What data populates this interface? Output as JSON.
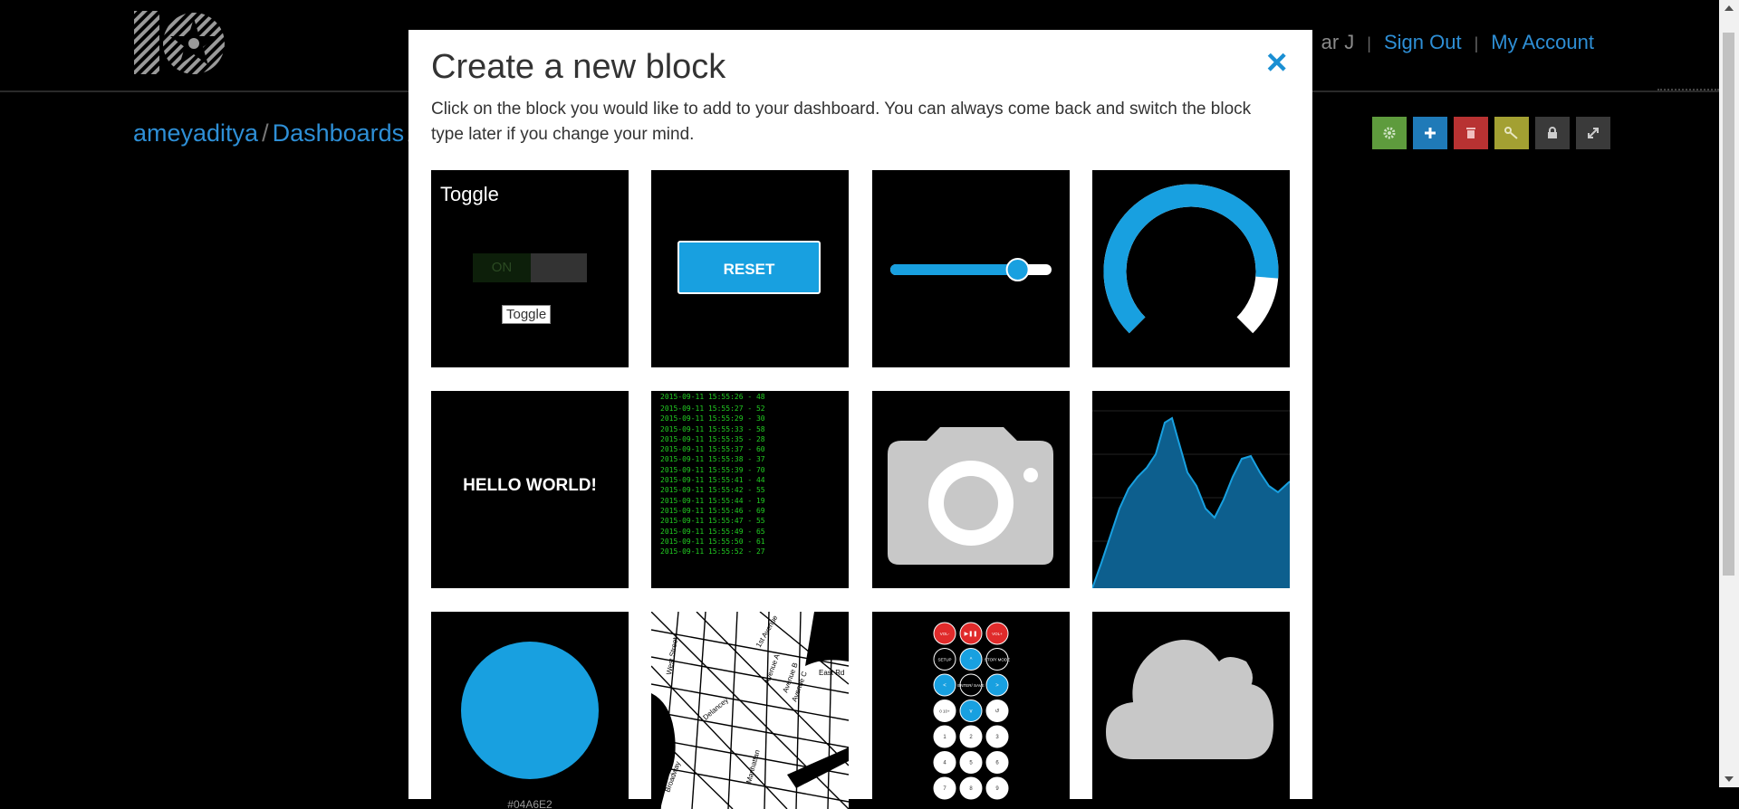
{
  "header": {
    "user_partial": "ar J",
    "sign_out": "Sign Out",
    "my_account": "My Account",
    "separator": "|"
  },
  "breadcrumb": {
    "user": "ameyaditya",
    "dashboards": "Dashboards",
    "separator": "/"
  },
  "toolbar": {
    "buttons": [
      {
        "name": "settings",
        "color": "#5e9b3d",
        "icon": "gear"
      },
      {
        "name": "add-block",
        "color": "#1f7ab8",
        "icon": "plus"
      },
      {
        "name": "delete",
        "color": "#b83232",
        "icon": "trash"
      },
      {
        "name": "key",
        "color": "#a3a032",
        "icon": "key"
      },
      {
        "name": "lock",
        "color": "#3a3a3a",
        "icon": "lock"
      },
      {
        "name": "fullscreen",
        "color": "#3a3a3a",
        "icon": "expand"
      }
    ]
  },
  "modal": {
    "title": "Create a new block",
    "close_icon": "×",
    "description": "Click on the block you would like to add to your dashboard. You can always come back and switch the block type later if you change your mind.",
    "accent_color": "#18a0e0",
    "tiles": {
      "toggle": {
        "title": "Toggle",
        "on_label": "ON",
        "tooltip": "Toggle"
      },
      "momentary_button": {
        "label": "RESET"
      },
      "slider": {
        "level": 0.79
      },
      "gauge": {
        "level": 0.85
      },
      "text": {
        "label": "HELLO WORLD!"
      },
      "stream": {
        "partial_top": "2015-09-11 15:55:26 - 48",
        "lines": [
          "2015-09-11 15:55:27 - 52",
          "2015-09-11 15:55:29 - 30",
          "2015-09-11 15:55:33 - 58",
          "2015-09-11 15:55:35 - 28",
          "2015-09-11 15:55:37 - 60",
          "2015-09-11 15:55:38 - 37",
          "2015-09-11 15:55:39 - 70",
          "2015-09-11 15:55:41 - 44",
          "2015-09-11 15:55:42 - 55",
          "2015-09-11 15:55:44 - 19",
          "2015-09-11 15:55:46 - 69",
          "2015-09-11 15:55:47 - 55",
          "2015-09-11 15:55:49 - 65",
          "2015-09-11 15:55:50 - 61",
          "2015-09-11 15:55:52 - 27"
        ]
      },
      "image": {
        "icon": "camera-icon"
      },
      "line_chart": {
        "icon": "area-chart-icon"
      },
      "color_picker": {
        "label_partial": "#04A6E2"
      },
      "map": {
        "icon": "street-map-icon",
        "streets": [
          "West Street",
          "1st Avenue",
          "Avenue A",
          "Avenue B",
          "Avenue C",
          "East Rd",
          "Broadway",
          "Delancey",
          "Manhattan"
        ]
      },
      "remote_control": {
        "rows": [
          [
            "VOL-",
            "▶❚❚",
            "VOL+"
          ],
          [
            "SETUP",
            "^",
            "STOP/ MODE"
          ],
          [
            "<",
            "ENTER/ SAVE",
            ">"
          ],
          [
            "0 10+",
            "v",
            "↺"
          ],
          [
            "1",
            "2",
            "3"
          ],
          [
            "4",
            "5",
            "6"
          ],
          [
            "7",
            "8",
            "9"
          ]
        ]
      },
      "weather": {
        "icon": "cloud-icon"
      }
    }
  }
}
